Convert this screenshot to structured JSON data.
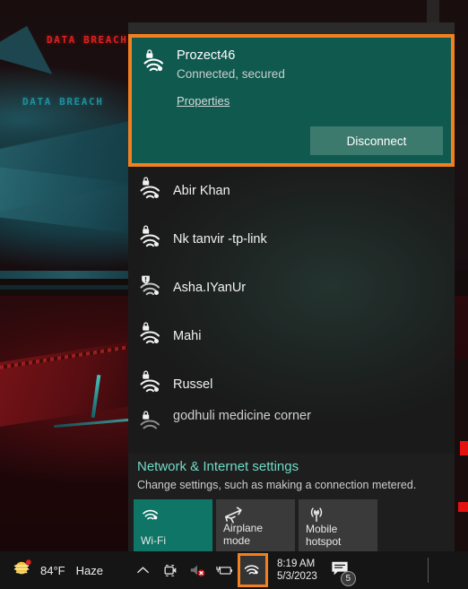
{
  "desktop": {
    "wallpaper_texts": [
      {
        "text": "DATA BREACH",
        "color": "#e02121"
      },
      {
        "text": "DATA BREACH",
        "color": "#1f8f9c"
      }
    ]
  },
  "flyout": {
    "connected": {
      "ssid": "Prozect46",
      "status": "Connected, secured",
      "properties_link": "Properties",
      "disconnect_label": "Disconnect",
      "icon": "wifi-secured-icon",
      "highlight_color": "#f28020",
      "panel_color": "#10594f",
      "button_color": "#3d7a6e"
    },
    "networks": [
      {
        "name": "Abir Khan",
        "icon": "wifi-secured-icon",
        "secured": true
      },
      {
        "name": "Nk tanvir -tp-link",
        "icon": "wifi-secured-icon",
        "secured": true
      },
      {
        "name": "Asha.IYanUr",
        "icon": "wifi-warning-icon",
        "secured": false
      },
      {
        "name": "Mahi",
        "icon": "wifi-secured-icon",
        "secured": true
      },
      {
        "name": "Russel",
        "icon": "wifi-secured-icon",
        "secured": true
      },
      {
        "name": "godhuli medicine corner",
        "icon": "wifi-secured-icon",
        "secured": true
      }
    ],
    "settings": {
      "link": "Network & Internet settings",
      "description": "Change settings, such as making a connection metered.",
      "link_color": "#6fdbc8"
    },
    "tiles": [
      {
        "label": "Wi-Fi",
        "icon": "wifi-icon",
        "active": true
      },
      {
        "label": "Airplane mode",
        "icon": "airplane-icon",
        "active": false
      },
      {
        "label": "Mobile hotspot",
        "label_line1": "Mobile",
        "label_line2": "hotspot",
        "icon": "hotspot-icon",
        "active": false
      }
    ]
  },
  "taskbar": {
    "weather": {
      "icon": "haze-sun-icon",
      "temperature": "84°F",
      "condition": "Haze"
    },
    "tray": [
      {
        "name": "show-hidden-icons-chevron",
        "icon": "chevron-up-icon"
      },
      {
        "name": "camera-icon",
        "icon": "camera-icon"
      },
      {
        "name": "volume-muted-icon",
        "icon": "speaker-mute-icon"
      },
      {
        "name": "battery-icon",
        "icon": "battery-plug-icon"
      },
      {
        "name": "network-wifi-icon",
        "icon": "wifi-icon",
        "highlighted": true
      }
    ],
    "clock": {
      "time": "8:19 AM",
      "date": "5/3/2023"
    },
    "notifications": {
      "icon": "chat-notification-icon",
      "count": "5"
    }
  }
}
